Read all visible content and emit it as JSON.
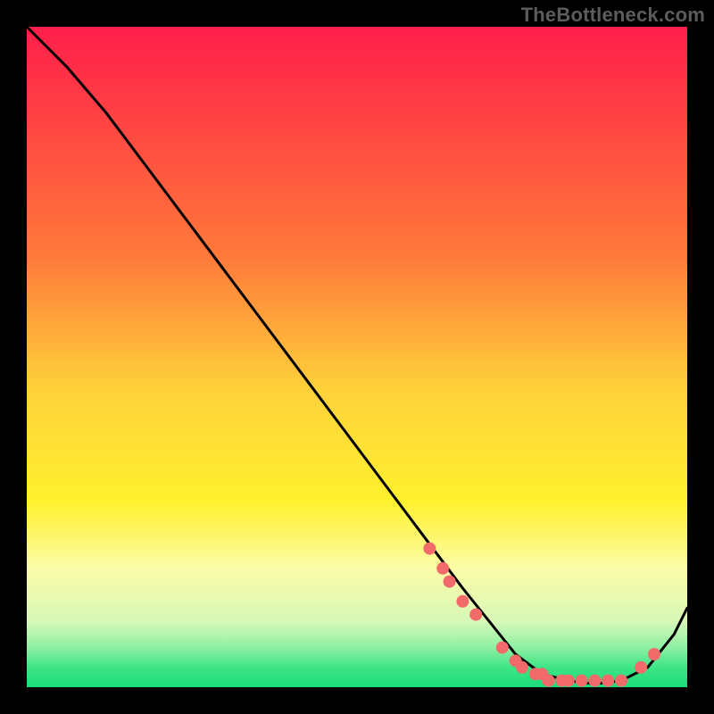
{
  "watermark": "TheBottleneck.com",
  "colors": {
    "background": "#000000",
    "curve_stroke": "#000000",
    "dot_fill": "#f26a6a",
    "gradient_stops": [
      {
        "offset": 0,
        "color": "#ff1e4a"
      },
      {
        "offset": 0.35,
        "color": "#ff7a3a"
      },
      {
        "offset": 0.55,
        "color": "#ffd23a"
      },
      {
        "offset": 0.72,
        "color": "#fff12e"
      },
      {
        "offset": 0.82,
        "color": "#fbfca8"
      },
      {
        "offset": 0.9,
        "color": "#d8f8b8"
      },
      {
        "offset": 0.94,
        "color": "#8ef0a4"
      },
      {
        "offset": 0.97,
        "color": "#3ee486"
      },
      {
        "offset": 1.0,
        "color": "#1bdc7a"
      }
    ]
  },
  "chart_data": {
    "type": "line",
    "title": "",
    "xlabel": "",
    "ylabel": "",
    "xlim": [
      0,
      100
    ],
    "ylim": [
      0,
      100
    ],
    "series": [
      {
        "name": "bottleneck-curve",
        "x": [
          0,
          6,
          12,
          18,
          24,
          30,
          36,
          42,
          48,
          54,
          60,
          66,
          70,
          74,
          78,
          82,
          86,
          90,
          94,
          98,
          100
        ],
        "y": [
          100,
          94,
          87,
          79,
          71,
          63,
          55,
          47,
          39,
          31,
          23,
          15,
          10,
          5,
          2,
          1,
          0.5,
          1,
          3,
          8,
          12
        ]
      }
    ],
    "highlight_points": {
      "name": "sweet-spot-dots",
      "x": [
        61,
        63,
        64,
        66,
        68,
        72,
        74,
        75,
        77,
        78,
        79,
        81,
        82,
        84,
        86,
        88,
        90,
        93,
        95
      ],
      "y": [
        21,
        18,
        16,
        13,
        11,
        6,
        4,
        3,
        2,
        2,
        1,
        1,
        1,
        1,
        1,
        1,
        1,
        3,
        5
      ]
    }
  }
}
